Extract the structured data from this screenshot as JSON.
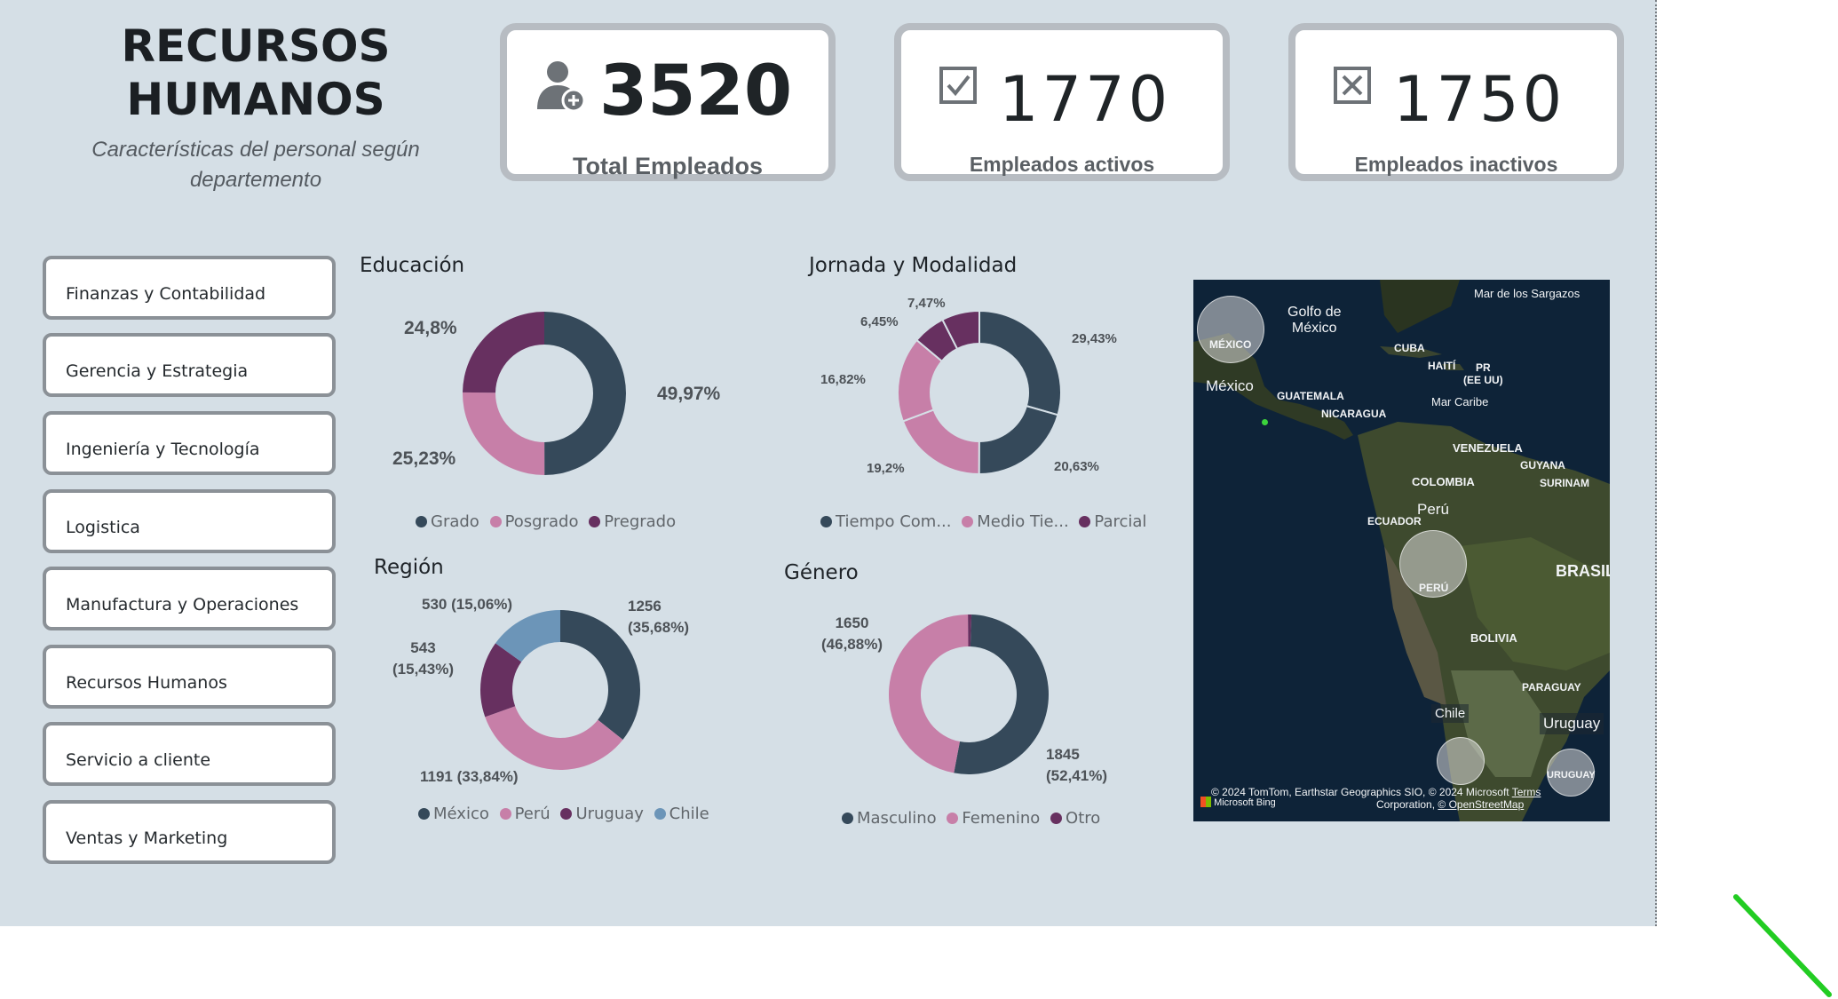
{
  "header": {
    "title_line1": "RECURSOS",
    "title_line2": "HUMANOS",
    "subtitle_line1": "Características del personal según",
    "subtitle_line2": "departemento"
  },
  "kpis": [
    {
      "value": "3520",
      "label": "Total Empleados",
      "icon": "person-add-icon"
    },
    {
      "value": "1770",
      "label": "Empleados activos",
      "icon": "checkbox-checked-icon"
    },
    {
      "value": "1750",
      "label": "Empleados inactivos",
      "icon": "checkbox-x-icon"
    }
  ],
  "departments": [
    "Finanzas y Contabilidad",
    "Gerencia y Estrategia",
    "Ingeniería y Tecnología",
    "Logistica",
    "Manufactura y Operaciones",
    "Recursos Humanos",
    "Servicio a cliente",
    "Ventas y Marketing"
  ],
  "colors": {
    "dark": "#35495a",
    "pink": "#c77fa8",
    "purple": "#673060",
    "blue": "#6c95b8",
    "background": "#d5dfe6"
  },
  "chart_data": [
    {
      "type": "pie",
      "title": "Educación",
      "categories": [
        "Grado",
        "Posgrado",
        "Pregrado"
      ],
      "values": [
        49.97,
        25.23,
        24.8
      ],
      "data_labels": [
        "49,97%",
        "25,23%",
        "24,8%"
      ],
      "legend": "bottom"
    },
    {
      "type": "pie",
      "title": "Jornada y Modalidad",
      "slice_values": [
        29.43,
        20.63,
        19.2,
        16.82,
        6.45,
        7.47
      ],
      "slice_colors": [
        "dark",
        "dark",
        "pink",
        "pink",
        "purple",
        "purple"
      ],
      "data_labels": [
        "29,43%",
        "20,63%",
        "19,2%",
        "16,82%",
        "6,45%",
        "7,47%"
      ],
      "legend_entries": [
        "Tiempo Com...",
        "Medio Tie...",
        "Parcial"
      ],
      "legend": "bottom"
    },
    {
      "type": "pie",
      "title": "Región",
      "categories": [
        "México",
        "Perú",
        "Uruguay",
        "Chile"
      ],
      "values": [
        1256,
        1191,
        543,
        530
      ],
      "data_labels_line1": [
        "1256",
        "1191 (33,84%)",
        "543",
        "530 (15,06%)"
      ],
      "data_labels_line2": [
        "(35,68%)",
        "",
        "(15,43%)",
        ""
      ],
      "legend": "bottom"
    },
    {
      "type": "pie",
      "title": "Género",
      "categories": [
        "Masculino",
        "Femenino",
        "Otro"
      ],
      "values": [
        1845,
        1650,
        25
      ],
      "data_labels_line1": [
        "1845",
        "1650"
      ],
      "data_labels_line2": [
        "(52,41%)",
        "(46,88%)"
      ],
      "legend": "bottom"
    }
  ],
  "map": {
    "labels": {
      "sargazos": "Mar de los Sargazos",
      "golfo1": "Golfo de",
      "golfo2": "México",
      "cuba": "CUBA",
      "haiti": "HAITÍ",
      "pr1": "PR",
      "pr2": "(EE UU)",
      "mexico_caps": "MÉXICO",
      "mexico": "México",
      "guatemala": "GUATEMALA",
      "nicaragua": "NICARAGUA",
      "caribe": "Mar Caribe",
      "venezuela": "VENEZUELA",
      "guyana": "GUYANA",
      "colombia": "COLOMBIA",
      "surinam": "SURINAM",
      "peru": "Perú",
      "ecuador": "ECUADOR",
      "peru_caps": "PERÚ",
      "brasil": "BRASIL",
      "bolivia": "BOLIVIA",
      "paraguay": "PARAGUAY",
      "chile": "Chile",
      "uruguay": "Uruguay",
      "uruguay_caps": "URUGUAY"
    },
    "attribution_line1": "© 2024 TomTom, Earthstar Geographics SIO, © 2024 Microsoft",
    "attribution_terms": "Terms",
    "attribution_line2": "Corporation,",
    "attribution_osm": "© OpenStreetMap",
    "bing": "Microsoft Bing"
  }
}
